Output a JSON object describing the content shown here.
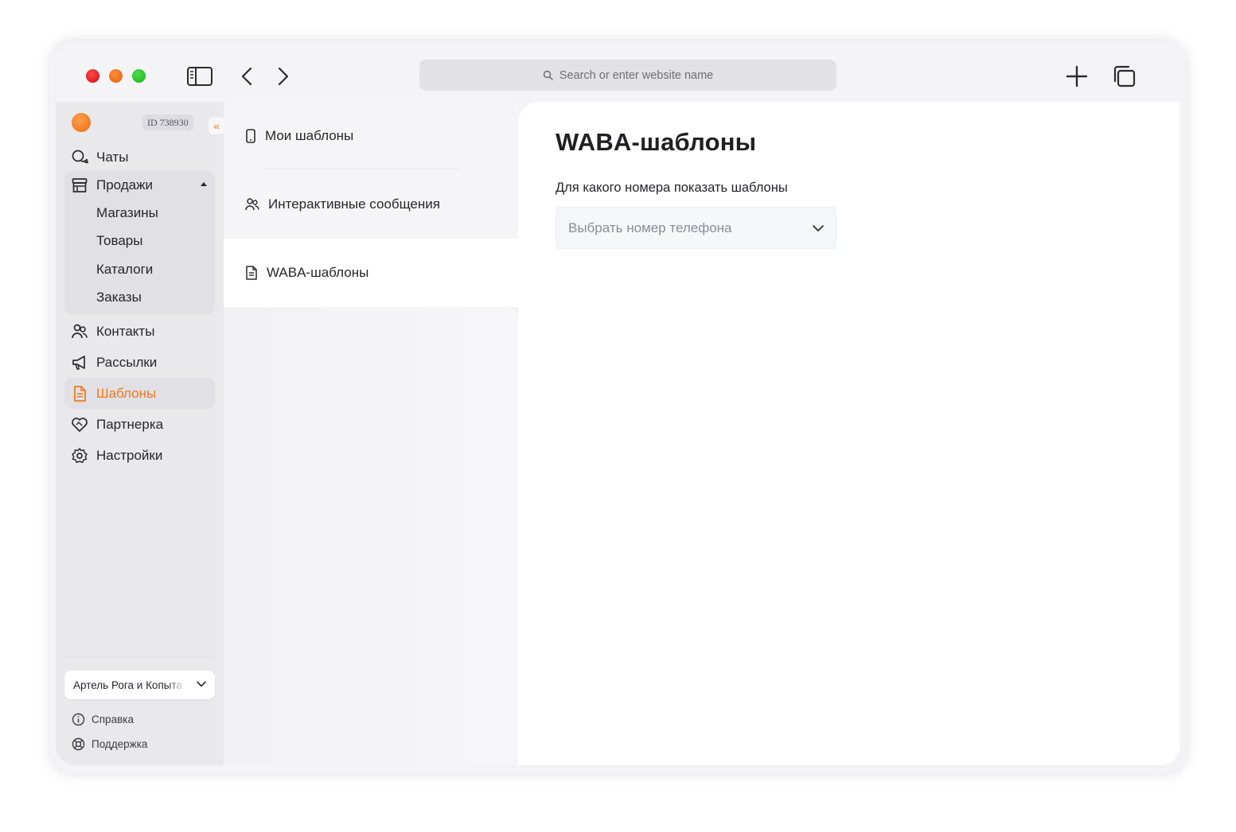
{
  "browser": {
    "url_placeholder": "Search or enter website name"
  },
  "account": {
    "id_label": "ID 738930",
    "collapse_glyph": "«"
  },
  "nav": {
    "chats": "Чаты",
    "sales": "Продажи",
    "sales_sub": [
      "Магазины",
      "Товары",
      "Каталоги",
      "Заказы"
    ],
    "contacts": "Контакты",
    "mailings": "Рассылки",
    "templates": "Шаблоны",
    "partner": "Партнерка",
    "settings": "Настройки"
  },
  "company": {
    "name": "Артель Рога и Копыта"
  },
  "footer": {
    "help": "Справка",
    "support": "Поддержка"
  },
  "template_tabs": {
    "my_templates": "Мои шаблоны",
    "interactive": "Интерактивные сообщения",
    "waba": "WABA-шаблоны"
  },
  "main": {
    "title": "WABA-шаблоны",
    "phone_label": "Для какого номера показать шаблоны",
    "phone_placeholder": "Выбрать номер телефона"
  },
  "colors": {
    "accent": "#f07a1a",
    "sidebar_bg": "#e9e9ec",
    "text": "#26262b"
  }
}
